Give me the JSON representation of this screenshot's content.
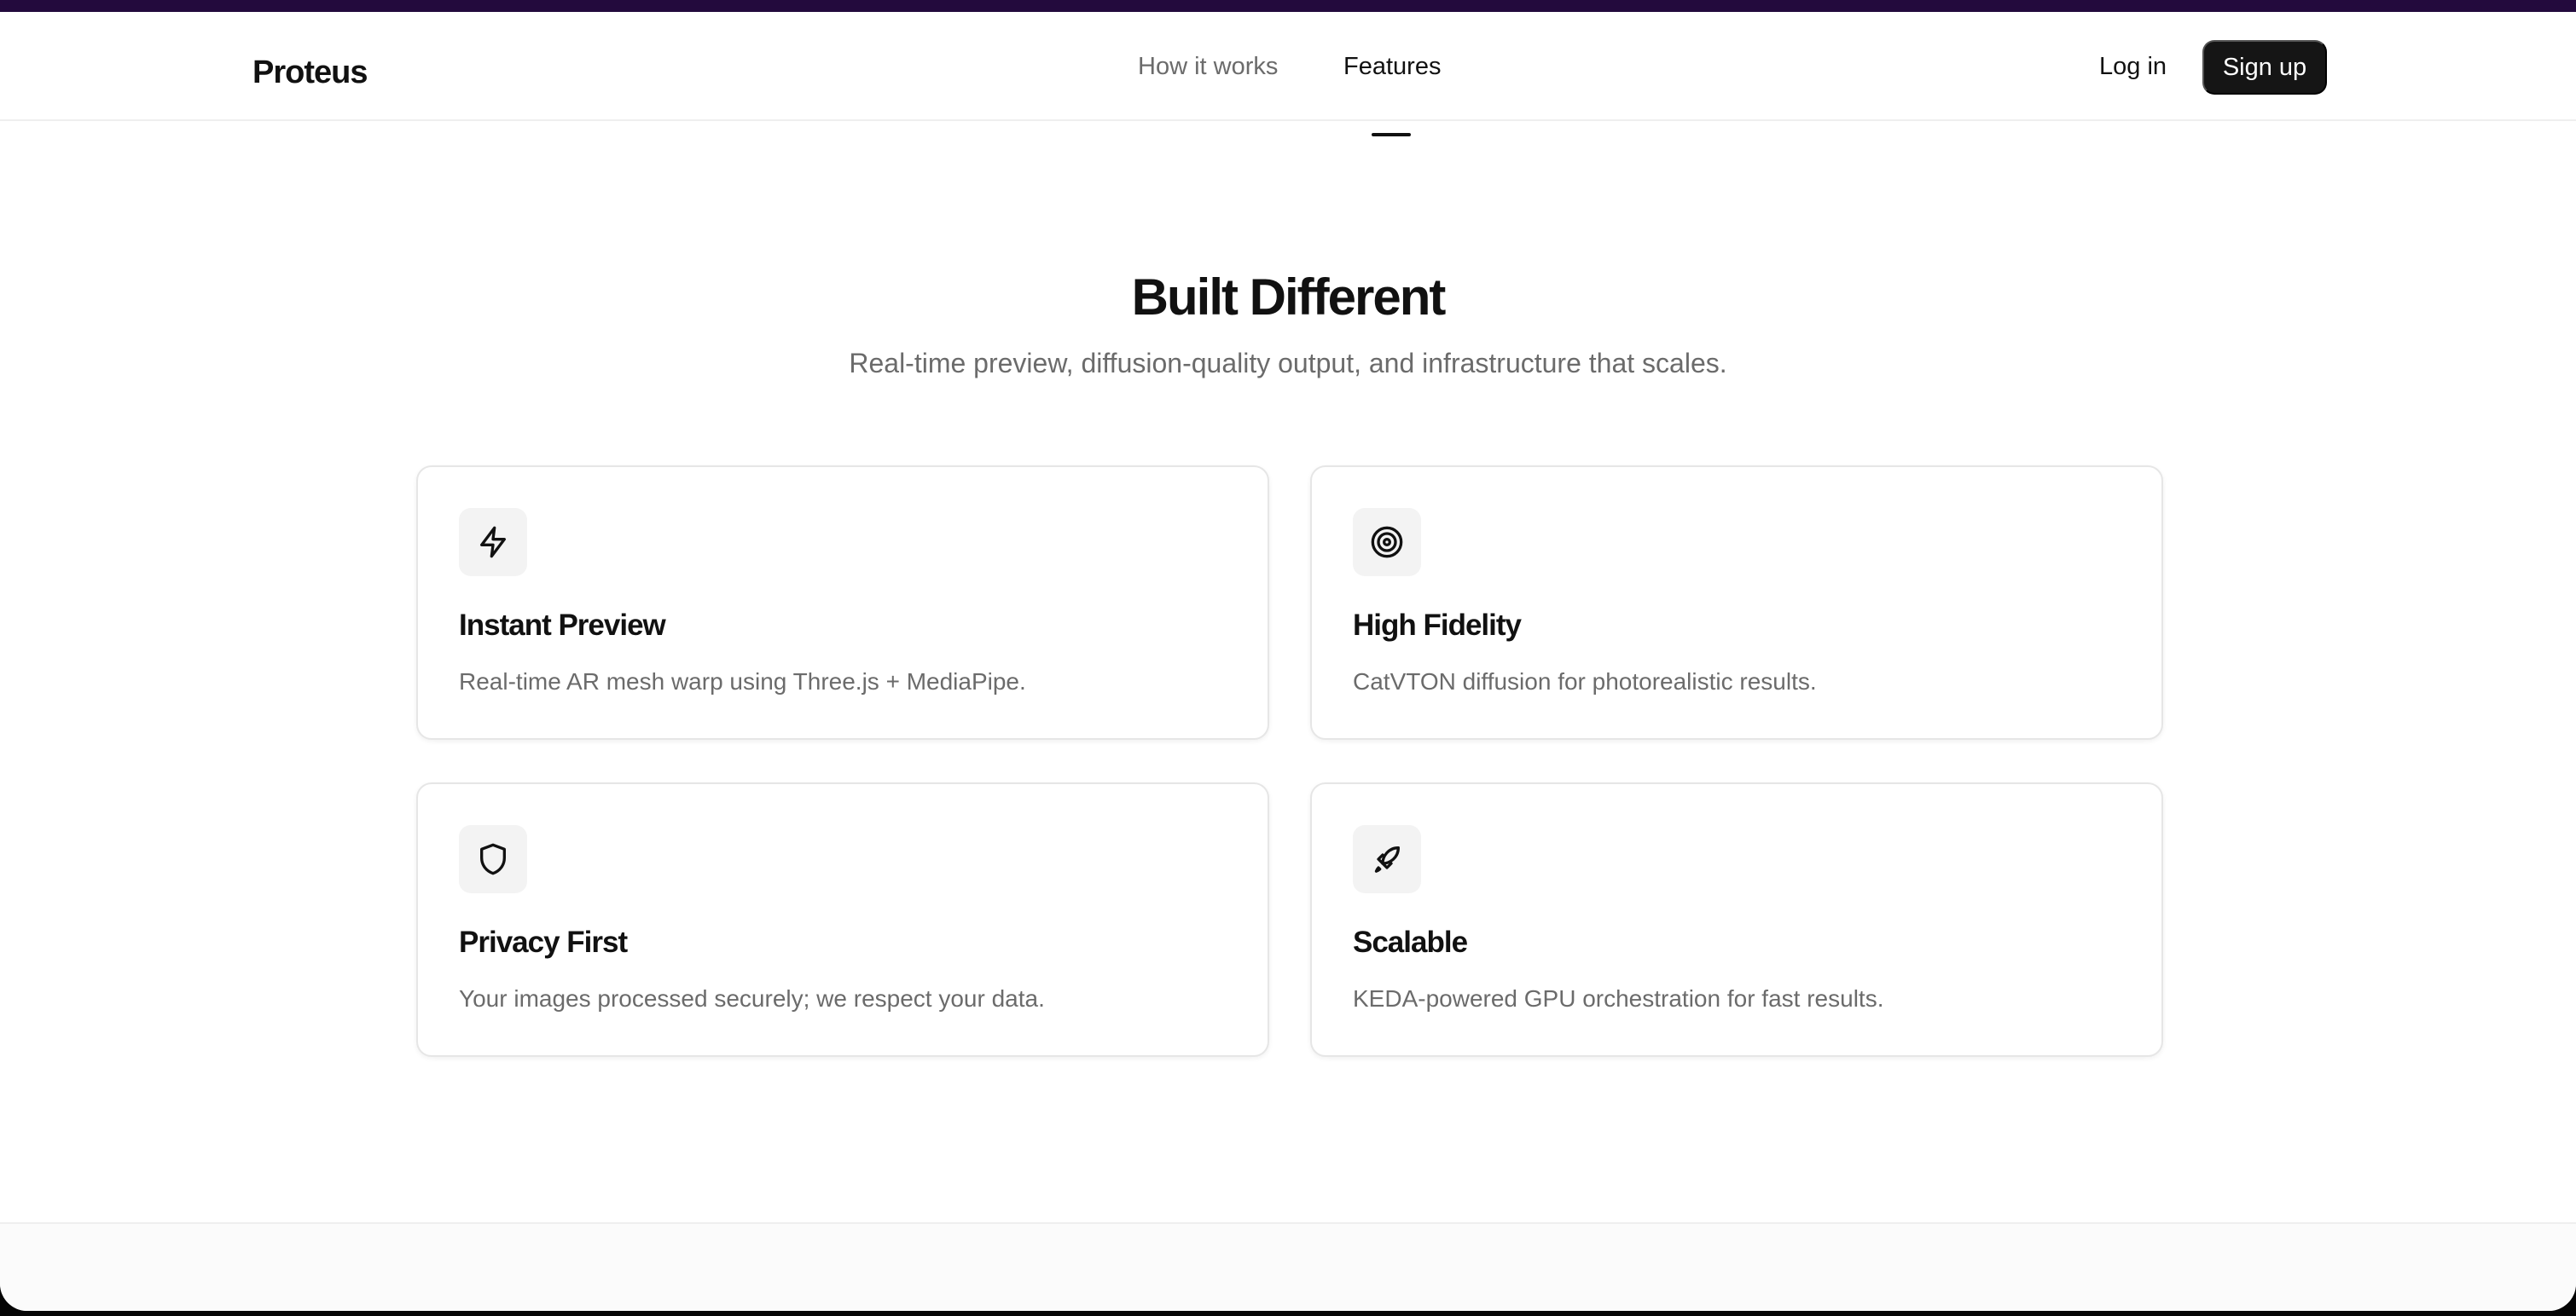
{
  "header": {
    "logo": "Proteus",
    "nav": [
      {
        "label": "How it works",
        "active": false
      },
      {
        "label": "Features",
        "active": true
      }
    ],
    "login_label": "Log in",
    "signup_label": "Sign up"
  },
  "hero": {
    "title": "Built Different",
    "subtitle": "Real-time preview, diffusion-quality output, and infrastructure that scales."
  },
  "features": [
    {
      "icon": "lightning-icon",
      "title": "Instant Preview",
      "description": "Real-time AR mesh warp using Three.js + MediaPipe."
    },
    {
      "icon": "target-icon",
      "title": "High Fidelity",
      "description": "CatVTON diffusion for photorealistic results."
    },
    {
      "icon": "shield-icon",
      "title": "Privacy First",
      "description": "Your images processed securely; we respect your data."
    },
    {
      "icon": "rocket-icon",
      "title": "Scalable",
      "description": "KEDA-powered GPU orchestration for fast results."
    }
  ],
  "colors": {
    "accent": "#151515",
    "top_bar": "#230a3d",
    "muted_text": "#6b6b6b",
    "card_border": "#e6e6e6"
  }
}
